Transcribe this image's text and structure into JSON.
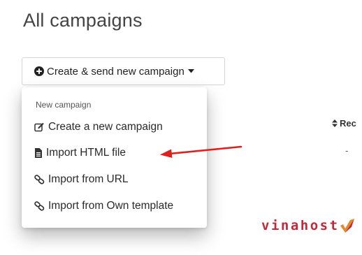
{
  "page": {
    "title": "All campaigns"
  },
  "dropdown": {
    "button_label": "Create & send new campaign",
    "plus_icon": "plus-circle-icon",
    "caret_icon": "caret-down-icon"
  },
  "menu": {
    "header": "New campaign",
    "items": [
      {
        "label": "Create a new campaign",
        "icon": "edit-icon"
      },
      {
        "label": "Import HTML file",
        "icon": "file-icon"
      },
      {
        "label": "Import from URL",
        "icon": "link-icon"
      },
      {
        "label": "Import from Own template",
        "icon": "link-icon"
      }
    ]
  },
  "annotation": {
    "arrow_color": "#e0201c",
    "points_to": "Import HTML file"
  },
  "table": {
    "column_header": "Rec",
    "cell_value": "-"
  },
  "watermark": {
    "text": "vinahost",
    "color": "#c02a3a"
  }
}
